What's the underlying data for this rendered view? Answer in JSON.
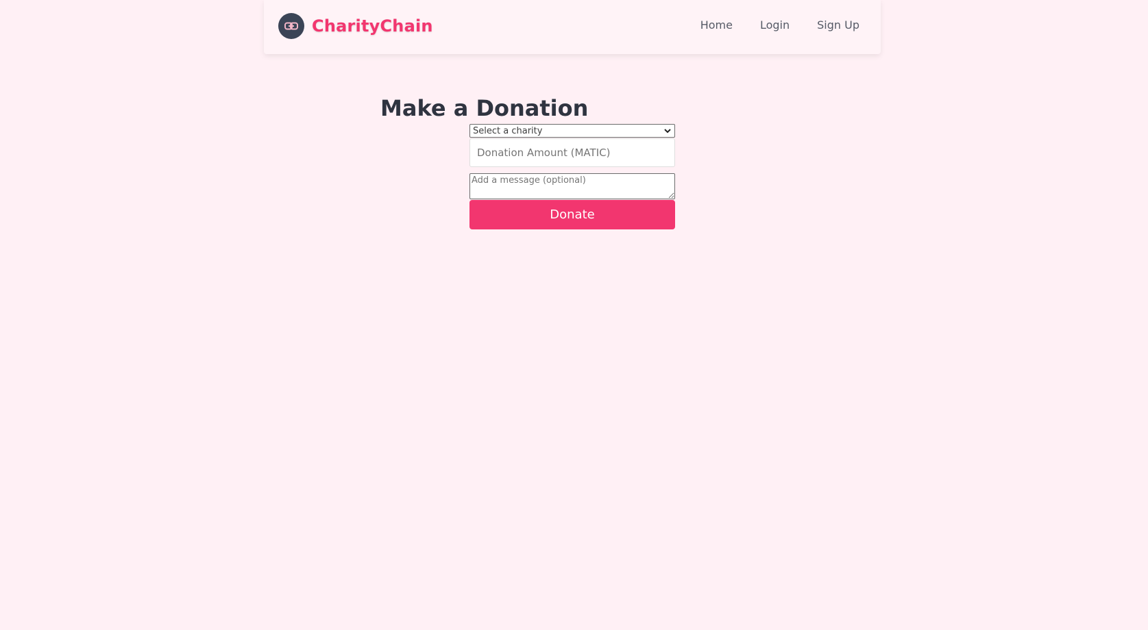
{
  "colors": {
    "page_background": "#fff0f5",
    "brand_accent": "#f2366f",
    "logo_background": "#3b4456",
    "button_background": "#f2366f",
    "button_text": "#ffffff"
  },
  "navbar": {
    "brand_name": "CharityChain",
    "logo_icon": "chain-link-icon",
    "links": [
      {
        "label": "Home"
      },
      {
        "label": "Login"
      },
      {
        "label": "Sign Up"
      }
    ]
  },
  "main": {
    "title": "Make a Donation",
    "form": {
      "charity_select": {
        "selected_value": "Select a charity",
        "icon": "chevron-down-icon"
      },
      "amount": {
        "value": "",
        "placeholder": "Donation Amount (MATIC)"
      },
      "message": {
        "value": "",
        "placeholder": "Add a message (optional)"
      },
      "submit_label": "Donate"
    }
  }
}
